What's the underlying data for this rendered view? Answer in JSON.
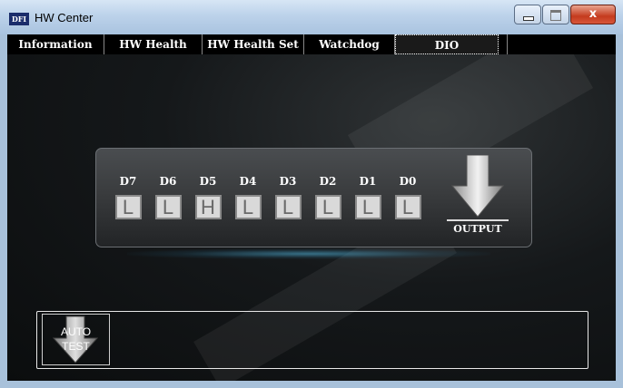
{
  "window": {
    "logo_text": "DFI",
    "title": "HW Center",
    "caption_buttons": {
      "close_glyph": "x"
    }
  },
  "tabs": [
    {
      "label": "Information",
      "active": false
    },
    {
      "label": "HW Health",
      "active": false
    },
    {
      "label": "HW Health Set",
      "active": false
    },
    {
      "label": "Watchdog",
      "active": false
    },
    {
      "label": "DIO",
      "active": true
    }
  ],
  "dio": {
    "bits": [
      {
        "label": "D7",
        "value": "L"
      },
      {
        "label": "D6",
        "value": "L"
      },
      {
        "label": "D5",
        "value": "H"
      },
      {
        "label": "D4",
        "value": "L"
      },
      {
        "label": "D3",
        "value": "L"
      },
      {
        "label": "D2",
        "value": "L"
      },
      {
        "label": "D1",
        "value": "L"
      },
      {
        "label": "D0",
        "value": "L"
      }
    ],
    "output_label": "OUTPUT",
    "output_icon": "down-arrow-icon"
  },
  "auto_test": {
    "line1": "AUTO",
    "line2": "TEST",
    "icon": "down-arrow-icon"
  },
  "colors": {
    "tab_bar": "#000000",
    "bit_box": "#d9d9d9",
    "close_button": "#c43b1e",
    "glow": "#50b4dc"
  }
}
